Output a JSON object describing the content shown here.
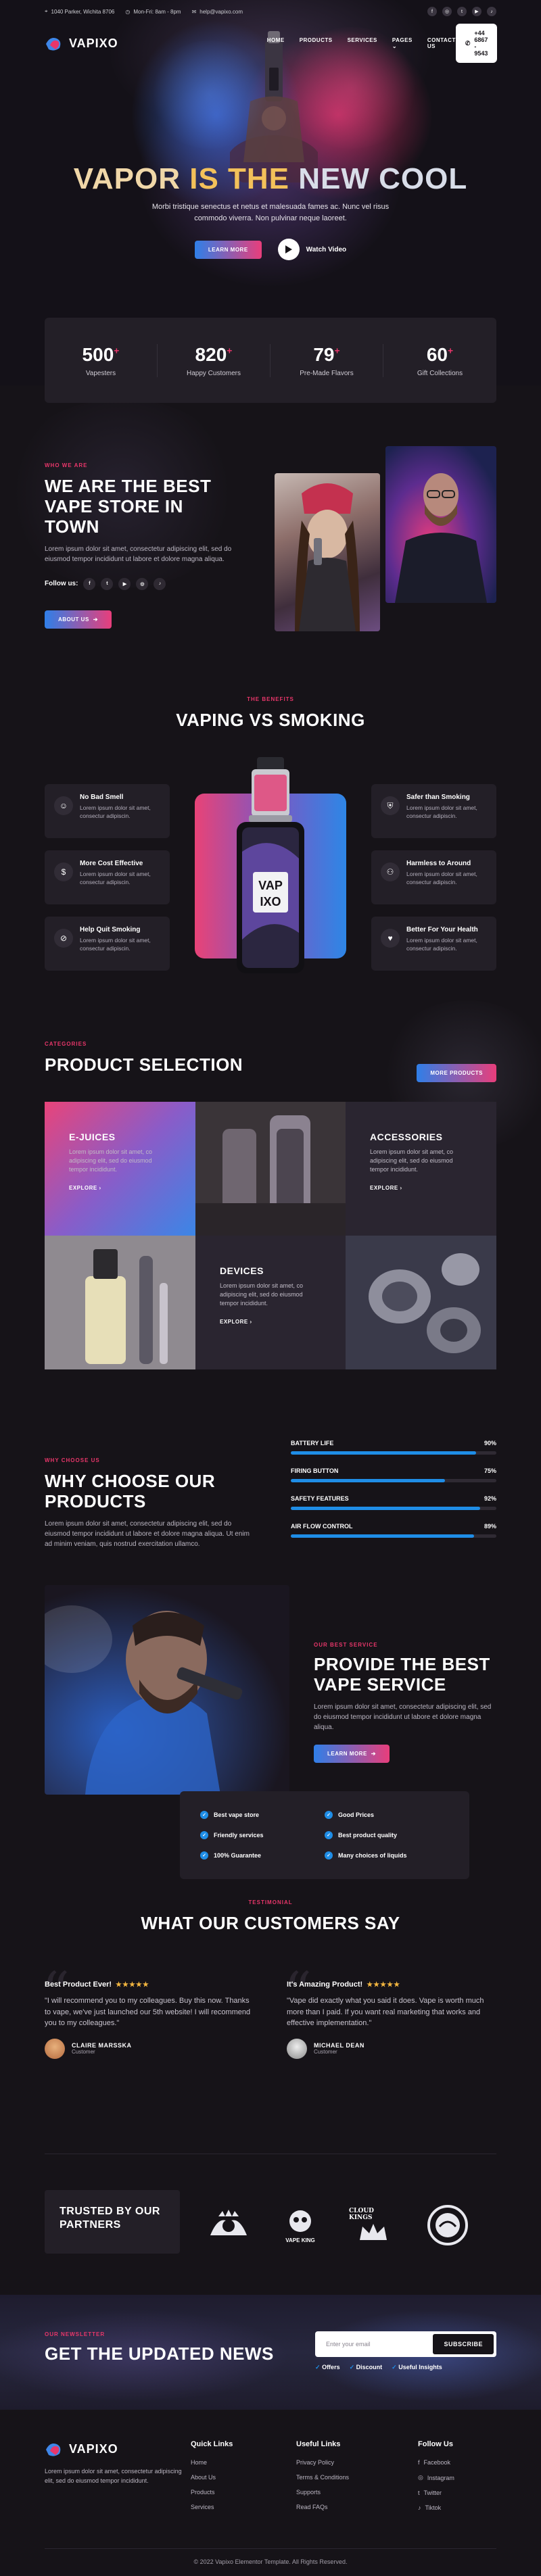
{
  "topbar": {
    "address": "1040 Parker, Wichita 8706",
    "hours": "Mon-Fri: 8am - 8pm",
    "email": "help@vapixo.com",
    "social_icons": [
      "facebook-icon",
      "instagram-icon",
      "twitter-icon",
      "youtube-icon",
      "tiktok-icon"
    ]
  },
  "nav": {
    "brand": "VAPIXO",
    "links": [
      "HOME",
      "PRODUCTS",
      "SERVICES",
      "PAGES",
      "CONTACT US"
    ],
    "phone": "+44 6867 - 9543"
  },
  "hero": {
    "title_1": "VAPOR",
    "title_2": "IS THE",
    "title_3": "NEW COOL",
    "subtitle": "Morbi tristique senectus et netus et malesuada fames ac. Nunc vel risus commodo viverra. Non pulvinar neque laoreet.",
    "cta": "LEARN MORE",
    "watch": "Watch Video"
  },
  "stats": [
    {
      "num": "500",
      "label": "Vapesters"
    },
    {
      "num": "820",
      "label": "Happy Customers"
    },
    {
      "num": "79",
      "label": "Pre-Made Flavors"
    },
    {
      "num": "60",
      "label": "Gift Collections"
    }
  ],
  "about": {
    "eyebrow": "WHO WE ARE",
    "title": "WE ARE THE BEST VAPE STORE IN TOWN",
    "text": "Lorem ipsum dolor sit amet, consectetur adipiscing elit, sed do eiusmod tempor incididunt ut labore et dolore magna aliqua.",
    "follow": "Follow us:",
    "cta": "ABOUT US"
  },
  "benefits": {
    "eyebrow": "THE BENEFITS",
    "title": "VAPING VS SMOKING",
    "left": [
      {
        "title": "No Bad Smell",
        "text": "Lorem ipsum dolor sit amet, consectur adipiscin."
      },
      {
        "title": "More Cost Effective",
        "text": "Lorem ipsum dolor sit amet, consectur adipiscin."
      },
      {
        "title": "Help Quit Smoking",
        "text": "Lorem ipsum dolor sit amet, consectur adipiscin."
      }
    ],
    "right": [
      {
        "title": "Safer than Smoking",
        "text": "Lorem ipsum dolor sit amet, consectur adipiscin."
      },
      {
        "title": "Harmless to Around",
        "text": "Lorem ipsum dolor sit amet, consectur adipiscin."
      },
      {
        "title": "Better For Your Health",
        "text": "Lorem ipsum dolor sit amet, consectur adipiscin."
      }
    ],
    "device_label_1": "VAP",
    "device_label_2": "IXO"
  },
  "products": {
    "eyebrow": "CATEGORIES",
    "title": "PRODUCT SELECTION",
    "cta": "MORE PRODUCTS",
    "tiles": [
      {
        "title": "E-JUICES",
        "text": "Lorem ipsum dolor sit amet, co adipiscing elit, sed do eiusmod tempor incididunt.",
        "link": "EXPLORE"
      },
      {
        "title": "ACCESSORIES",
        "text": "Lorem ipsum dolor sit amet, co adipiscing elit, sed do eiusmod tempor incididunt.",
        "link": "EXPLORE"
      },
      {
        "title": "DEVICES",
        "text": "Lorem ipsum dolor sit amet, co adipiscing elit, sed do eiusmod tempor incididunt.",
        "link": "EXPLORE"
      }
    ]
  },
  "why": {
    "eyebrow": "WHY CHOOSE US",
    "title": "WHY CHOOSE OUR PRODUCTS",
    "text": "Lorem ipsum dolor sit amet, consectetur adipiscing elit, sed do eiusmod tempor incididunt ut labore et dolore magna aliqua. Ut enim ad minim veniam, quis nostrud exercitation ullamco.",
    "bars": [
      {
        "label": "BATTERY LIFE",
        "pct": "90%",
        "value": 90
      },
      {
        "label": "FIRING BUTTON",
        "pct": "75%",
        "value": 75
      },
      {
        "label": "SAFETY FEATURES",
        "pct": "92%",
        "value": 92
      },
      {
        "label": "AIR FLOW CONTROL",
        "pct": "89%",
        "value": 89
      }
    ]
  },
  "service": {
    "eyebrow": "OUR BEST SERVICE",
    "title": "PROVIDE THE BEST VAPE SERVICE",
    "text": "Lorem ipsum dolor sit amet, consectetur adipiscing elit, sed do eiusmod tempor incididunt ut labore et dolore magna aliqua.",
    "cta": "LEARN MORE",
    "checks": [
      "Best vape store",
      "Good Prices",
      "Friendly services",
      "Best product quality",
      "100% Guarantee",
      "Many choices of liquids"
    ]
  },
  "testimonials": {
    "eyebrow": "TESTIMONIAL",
    "title": "WHAT OUR CUSTOMERS SAY",
    "items": [
      {
        "title": "Best Product Ever!",
        "stars": "★★★★★",
        "text": "\"I will recommend you to my colleagues. Buy this now. Thanks to vape, we've just launched our 5th website! I will recommend you to my colleagues.\"",
        "name": "CLAIRE MARSSKA",
        "role": "Customer"
      },
      {
        "title": "It's Amazing Product!",
        "stars": "★★★★★",
        "text": "\"Vape did exactly what you said it does. Vape is worth much more than I paid. If you want real marketing that works and effective implementation.\"",
        "name": "MICHAEL DEAN",
        "role": "Customer"
      }
    ]
  },
  "partners": {
    "title": "TRUSTED BY OUR PARTNERS",
    "logo_2": "VAPE KING",
    "logo_3": "CLOUD KINGS"
  },
  "newsletter": {
    "eyebrow": "OUR NEWSLETTER",
    "title": "GET THE UPDATED NEWS",
    "placeholder": "Enter your email",
    "button": "SUBSCRIBE",
    "checks": [
      "Offers",
      "Discount",
      "Useful Insights"
    ]
  },
  "footer": {
    "brand": "VAPIXO",
    "about": "Lorem ipsum dolor sit amet, consectetur adipiscing elit, sed do eiusmod tempor incididunt.",
    "quick_head": "Quick Links",
    "quick": [
      "Home",
      "About Us",
      "Products",
      "Services"
    ],
    "useful_head": "Useful Links",
    "useful": [
      "Privacy Policy",
      "Terms & Conditions",
      "Supports",
      "Read FAQs"
    ],
    "follow_head": "Follow Us",
    "follow": [
      "Facebook",
      "Instagram",
      "Twitter",
      "Tiktok"
    ],
    "copyright": "© 2022 Vapixo Elementor Template. All Rights Reserved."
  },
  "colors": {
    "accent_pink": "#e8366a",
    "accent_blue": "#1f8de6",
    "bg": "#161318",
    "card": "#231f27"
  }
}
